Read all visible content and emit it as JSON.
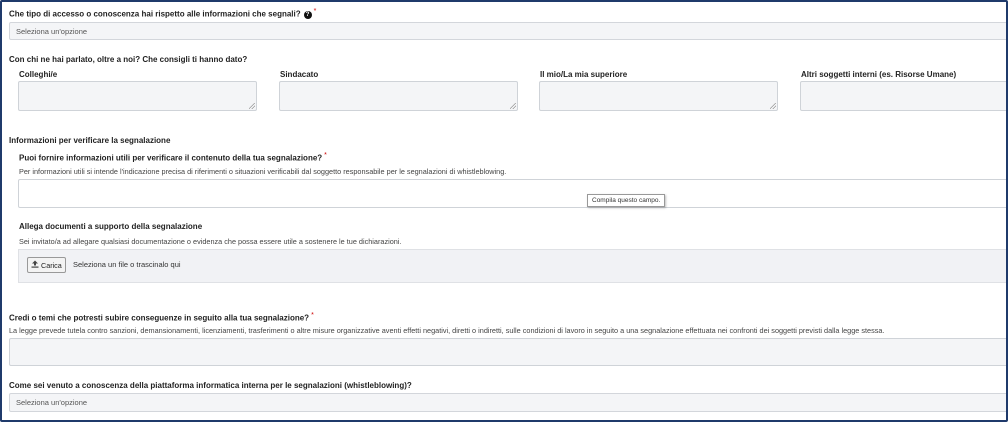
{
  "q1": {
    "label": "Che tipo di accesso o conoscenza hai rispetto alle informazioni che segnali?",
    "required": "*",
    "help_icon": "?",
    "select_value": "Seleziona un'opzione"
  },
  "contacts": {
    "heading": "Con chi ne hai parlato, oltre a noi? Che consigli ti hanno dato?",
    "fields": [
      "Colleghi/e",
      "Sindacato",
      "Il mio/La mia superiore",
      "Altri soggetti interni (es. Risorse Umane)"
    ]
  },
  "verify_section": {
    "heading": "Informazioni per verificare la segnalazione",
    "question": "Puoi fornire informazioni utili per verificare il contenuto della tua segnalazione?",
    "required": "*",
    "help": "Per informazioni utili si intende l'indicazione precisa di riferimenti o situazioni verificabili dal soggetto responsabile per le segnalazioni di whistleblowing.",
    "tooltip": "Compila questo campo."
  },
  "attach": {
    "label": "Allega documenti a supporto della segnalazione",
    "help": "Sei invitato/a ad allegare qualsiasi documentazione o evidenza che possa essere utile a sostenere le tue dichiarazioni.",
    "button_label": "Carica",
    "drop_text": "Seleziona un file o trascinalo qui"
  },
  "consequences": {
    "label": "Credi o temi che potresti subire conseguenze in seguito alla tua segnalazione?",
    "required": "*",
    "help": "La legge prevede tutela contro sanzioni, demansionamenti, licenziamenti, trasferimenti o altre misure organizzative aventi effetti negativi, diretti o indiretti, sulle condizioni di lavoro in seguito a una segnalazione effettuata nei confronti dei soggetti previsti dalla legge stessa."
  },
  "platform": {
    "label": "Come sei venuto a conoscenza della piattaforma informatica interna per le segnalazioni (whistleblowing)?",
    "select_value": "Seleziona un'opzione"
  },
  "colors": {
    "border": "#1f3a6b",
    "field_bg": "#f4f5f7",
    "required": "#cc0000"
  }
}
